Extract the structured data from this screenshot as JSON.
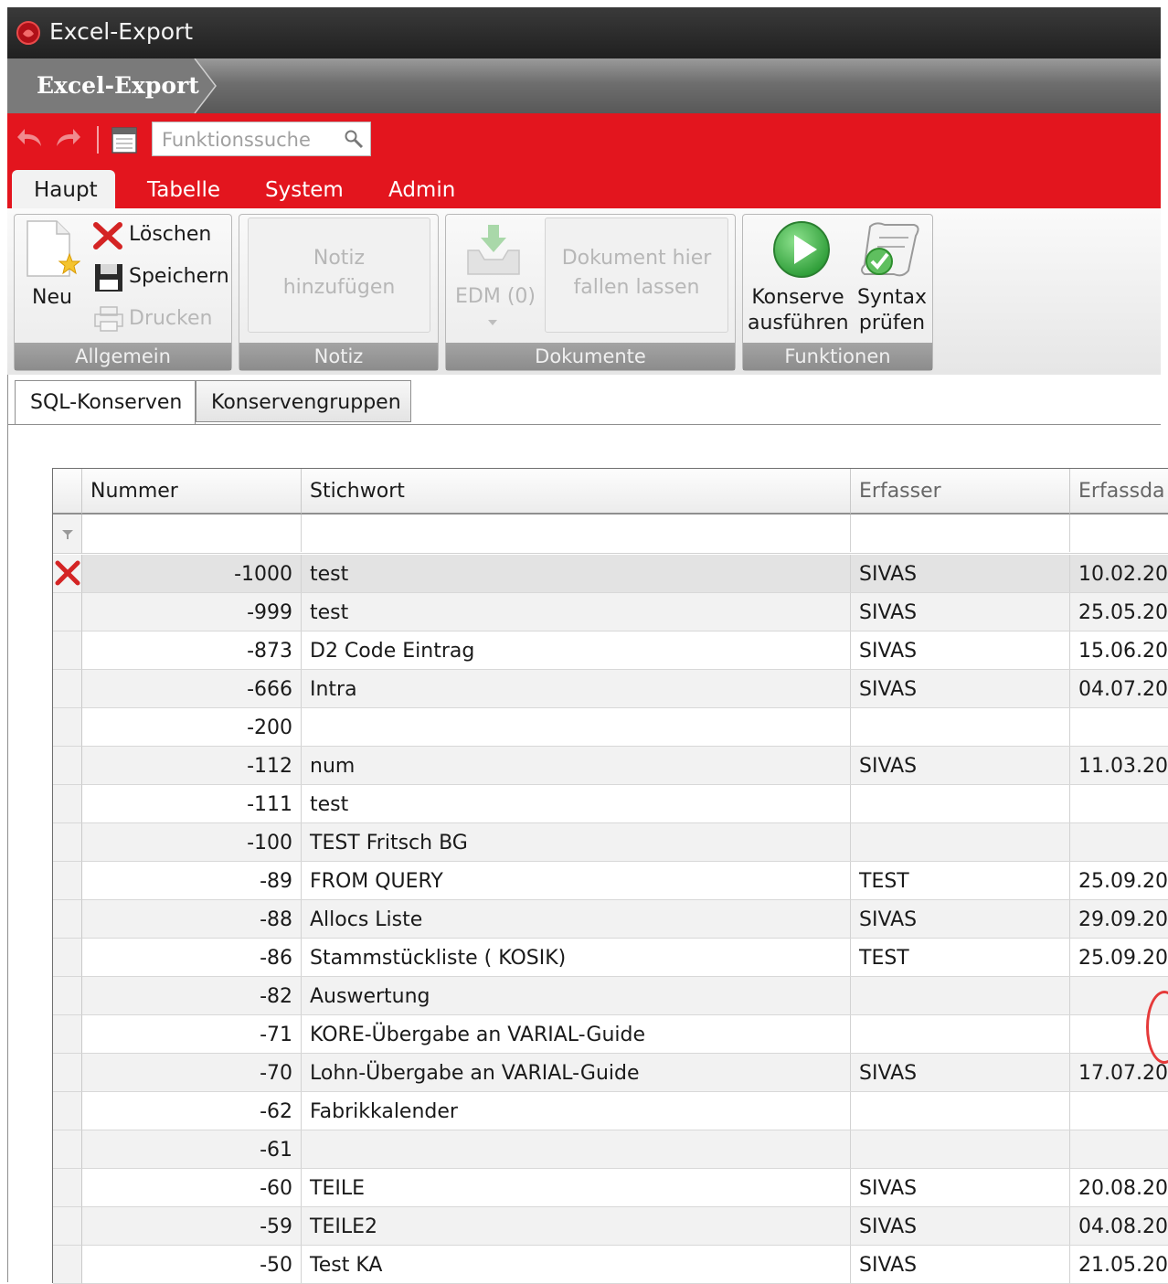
{
  "window": {
    "title": "Excel-Export"
  },
  "breadcrumb": {
    "label": "Excel-Export"
  },
  "toolbar": {
    "search_placeholder": "Funktionssuche"
  },
  "ribbon_tabs": [
    "Haupt",
    "Tabelle",
    "System",
    "Admin"
  ],
  "ribbon": {
    "allgemein": {
      "label": "Allgemein",
      "neu": "Neu",
      "loeschen": "Löschen",
      "speichern": "Speichern",
      "drucken": "Drucken"
    },
    "notiz": {
      "label": "Notiz",
      "line1": "Notiz",
      "line2": "hinzufügen"
    },
    "dokumente": {
      "label": "Dokumente",
      "edm": "EDM (0)",
      "drop1": "Dokument hier",
      "drop2": "fallen lassen"
    },
    "funktionen": {
      "label": "Funktionen",
      "konserve1": "Konserve",
      "konserve2": "ausführen",
      "syntax1": "Syntax",
      "syntax2": "prüfen"
    }
  },
  "subtabs": [
    "SQL-Konserven",
    "Konservengruppen"
  ],
  "grid": {
    "columns": [
      "Nummer",
      "Stichwort",
      "Erfasser",
      "Erfassda"
    ],
    "rows": [
      {
        "nummer": "-1000",
        "stichwort": "test",
        "erfasser": "SIVAS",
        "datum": "10.02.20"
      },
      {
        "nummer": "-999",
        "stichwort": "test",
        "erfasser": "SIVAS",
        "datum": "25.05.20"
      },
      {
        "nummer": "-873",
        "stichwort": "D2 Code Eintrag",
        "erfasser": "SIVAS",
        "datum": "15.06.20"
      },
      {
        "nummer": "-666",
        "stichwort": "Intra",
        "erfasser": "SIVAS",
        "datum": "04.07.20"
      },
      {
        "nummer": "-200",
        "stichwort": "",
        "erfasser": "",
        "datum": ""
      },
      {
        "nummer": "-112",
        "stichwort": "num",
        "erfasser": "SIVAS",
        "datum": "11.03.20"
      },
      {
        "nummer": "-111",
        "stichwort": "test",
        "erfasser": "",
        "datum": ""
      },
      {
        "nummer": "-100",
        "stichwort": "TEST Fritsch BG",
        "erfasser": "",
        "datum": ""
      },
      {
        "nummer": "-89",
        "stichwort": "FROM QUERY",
        "erfasser": "TEST",
        "datum": "25.09.20"
      },
      {
        "nummer": "-88",
        "stichwort": "Allocs Liste",
        "erfasser": "SIVAS",
        "datum": "29.09.20"
      },
      {
        "nummer": "-86",
        "stichwort": "Stammstückliste ( KOSIK)",
        "erfasser": "TEST",
        "datum": "25.09.20"
      },
      {
        "nummer": "-82",
        "stichwort": "Auswertung",
        "erfasser": "",
        "datum": ""
      },
      {
        "nummer": "-71",
        "stichwort": "KORE-Übergabe an VARIAL-Guide",
        "erfasser": "",
        "datum": ""
      },
      {
        "nummer": "-70",
        "stichwort": "Lohn-Übergabe an VARIAL-Guide",
        "erfasser": "SIVAS",
        "datum": "17.07.20"
      },
      {
        "nummer": "-62",
        "stichwort": "Fabrikkalender",
        "erfasser": "",
        "datum": ""
      },
      {
        "nummer": "-61",
        "stichwort": "",
        "erfasser": "",
        "datum": ""
      },
      {
        "nummer": "-60",
        "stichwort": "TEILE",
        "erfasser": "SIVAS",
        "datum": "20.08.20"
      },
      {
        "nummer": "-59",
        "stichwort": "TEILE2",
        "erfasser": "SIVAS",
        "datum": "04.08.20"
      },
      {
        "nummer": "-50",
        "stichwort": "Test KA",
        "erfasser": "SIVAS",
        "datum": "21.05.20"
      }
    ]
  },
  "colors": {
    "accent_red": "#e3151e",
    "play_green": "#3cb043"
  }
}
